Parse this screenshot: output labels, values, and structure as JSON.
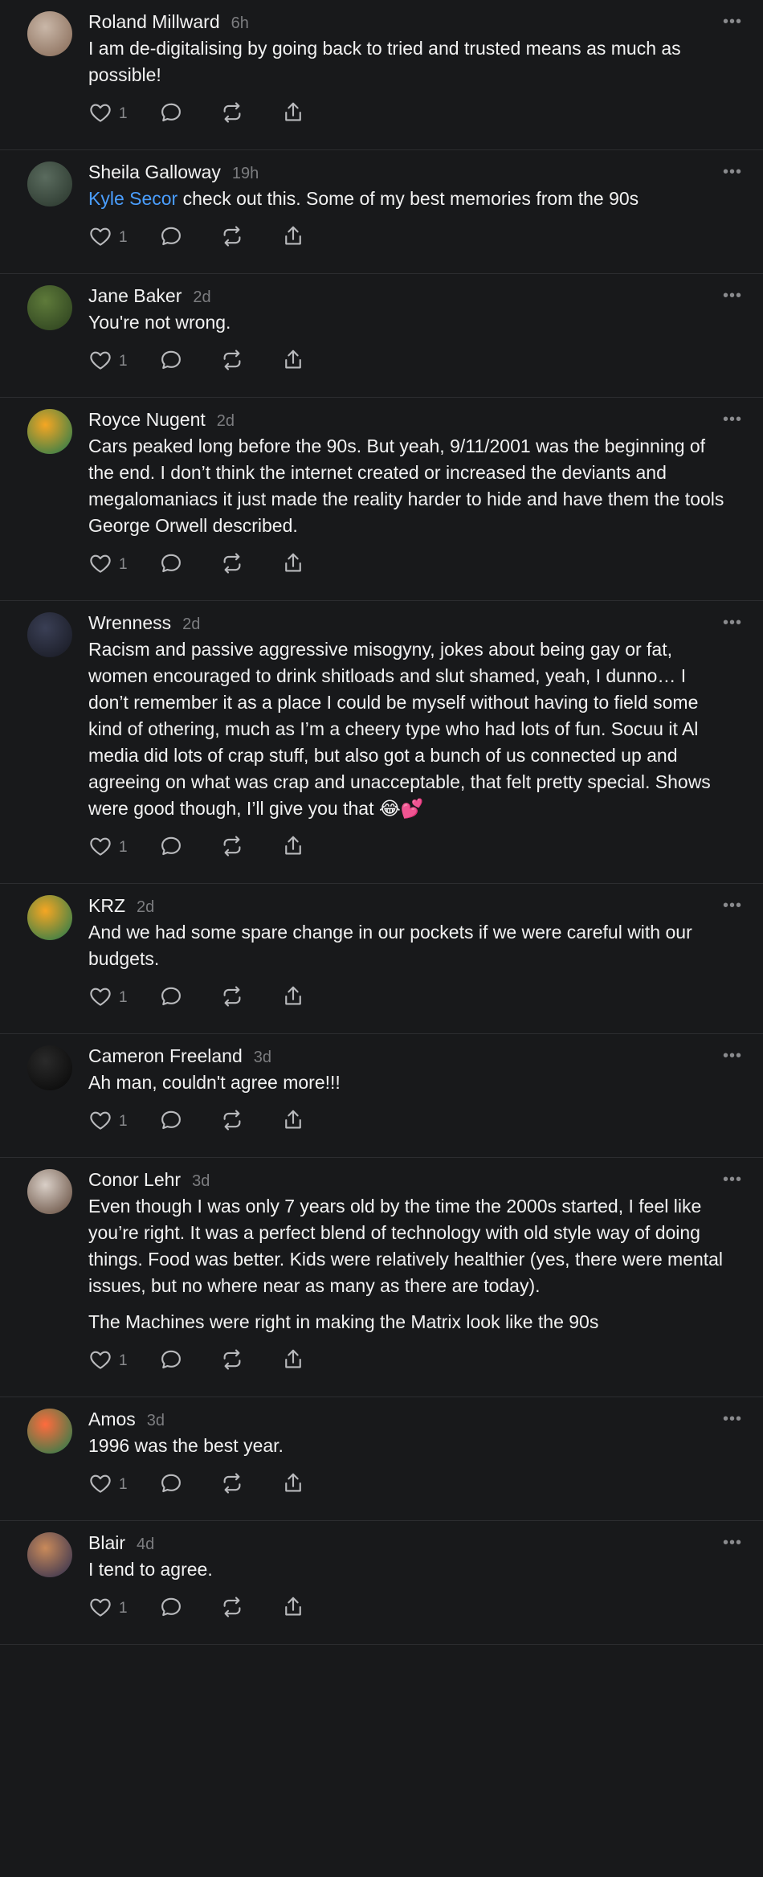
{
  "icons": {
    "like": "heart-icon",
    "reply": "speech-bubble-icon",
    "repost": "repost-arrows-icon",
    "share": "share-upload-icon",
    "more": "ellipsis-icon"
  },
  "more_glyph": "•••",
  "comments": [
    {
      "name": "Roland Millward",
      "time": "6h",
      "paragraphs": [
        "I am de-digitalising by going back to tried and trusted means as much as possible!"
      ],
      "likes": "1",
      "avatar_colors": [
        "#c9b7a8",
        "#8b6f5c"
      ]
    },
    {
      "name": "Sheila Galloway",
      "time": "19h",
      "mention": "Kyle Secor",
      "paragraphs": [
        " check out this. Some of my best memories from the 90s"
      ],
      "likes": "1",
      "avatar_colors": [
        "#5a6b5e",
        "#2d3a30"
      ]
    },
    {
      "name": "Jane Baker",
      "time": "2d",
      "paragraphs": [
        "You're not wrong."
      ],
      "likes": "1",
      "avatar_colors": [
        "#5e7a3a",
        "#2f4420"
      ]
    },
    {
      "name": "Royce Nugent",
      "time": "2d",
      "paragraphs": [
        "Cars peaked long before the 90s. But yeah, 9/11/2001 was the beginning of the end. I don’t think the internet created or increased the deviants and megalomaniacs it just made the reality harder to hide and have them the tools George Orwell described."
      ],
      "likes": "1",
      "avatar_colors": [
        "#f5a623",
        "#2f7d4a"
      ]
    },
    {
      "name": "Wrenness",
      "time": "2d",
      "paragraphs": [
        "Racism and passive aggressive misogyny, jokes about being gay or fat, women encouraged to drink shitloads and slut shamed, yeah, I dunno… I don’t remember it as a place I could be myself without having to field some kind of othering, much as I’m a cheery type who had lots of fun. Socuu it Al media did lots of crap stuff, but also got a bunch of us connected up and agreeing on what was crap and unacceptable, that felt pretty special. Shows were good though, I’ll give you that 😂💕"
      ],
      "likes": "1",
      "avatar_colors": [
        "#3a3f55",
        "#1a1c26"
      ]
    },
    {
      "name": "KRZ",
      "time": "2d",
      "paragraphs": [
        "And we had some spare change in our pockets if we were careful with our budgets."
      ],
      "likes": "1",
      "avatar_colors": [
        "#f5a623",
        "#2f7d4a"
      ]
    },
    {
      "name": "Cameron Freeland",
      "time": "3d",
      "paragraphs": [
        "Ah man, couldn't agree more!!!"
      ],
      "likes": "1",
      "avatar_colors": [
        "#2a2a2a",
        "#0a0a0a"
      ]
    },
    {
      "name": "Conor Lehr",
      "time": "3d",
      "paragraphs": [
        "Even though I was only 7 years old by the time the 2000s started, I feel like you’re right. It was a perfect blend of technology with old style way of doing things. Food was better. Kids were relatively healthier (yes, there were mental issues, but no where near as many as there are today).",
        "The Machines were right in making the Matrix look like the 90s"
      ],
      "likes": "1",
      "avatar_colors": [
        "#d9cfc7",
        "#6b5446"
      ]
    },
    {
      "name": "Amos",
      "time": "3d",
      "paragraphs": [
        "1996 was the best year."
      ],
      "likes": "1",
      "avatar_colors": [
        "#ff6b3d",
        "#2f7d4a"
      ]
    },
    {
      "name": "Blair",
      "time": "4d",
      "paragraphs": [
        "I tend to agree."
      ],
      "likes": "1",
      "avatar_colors": [
        "#c98a5a",
        "#3a3550"
      ]
    }
  ]
}
